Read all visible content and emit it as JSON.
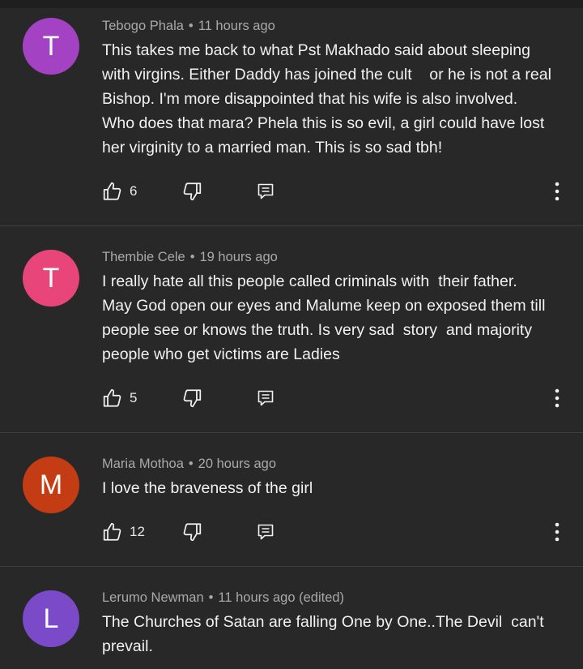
{
  "comments": [
    {
      "initial": "T",
      "avatar_color": "#a342c2",
      "author": "Tebogo Phala",
      "time": "11 hours ago",
      "text": "This takes me back to what Pst Makhado said about sleeping\nwith virgins. Either Daddy has joined the cult    or he is not a real\nBishop. I'm more disappointed that his wife is also involved.\nWho does that mara? Phela this is so evil, a girl could have lost\nher virginity to a married man. This is so sad tbh!",
      "likes": "6"
    },
    {
      "initial": "T",
      "avatar_color": "#e8467a",
      "author": "Thembie Cele",
      "time": "19 hours ago",
      "text": "I really hate all this people called criminals with  their father.\nMay God open our eyes and Malume keep on exposed them till\npeople see or knows the truth. Is very sad  story  and majority\npeople who get victims are Ladies",
      "likes": "5"
    },
    {
      "initial": "M",
      "avatar_color": "#c43c14",
      "author": "Maria Mothoa",
      "time": "20 hours ago",
      "text": "I love the braveness of the girl",
      "likes": "12"
    },
    {
      "initial": "L",
      "avatar_color": "#7b4ac9",
      "author": "Lerumo Newman",
      "time": "11 hours ago (edited)",
      "text": "The Churches of Satan are falling One by One..The Devil  can't\nprevail.",
      "likes": ""
    }
  ],
  "icons": {
    "like": "thumbs-up-icon",
    "dislike": "thumbs-down-icon",
    "reply": "reply-icon",
    "more": "more-vert-icon"
  },
  "separator": "•"
}
